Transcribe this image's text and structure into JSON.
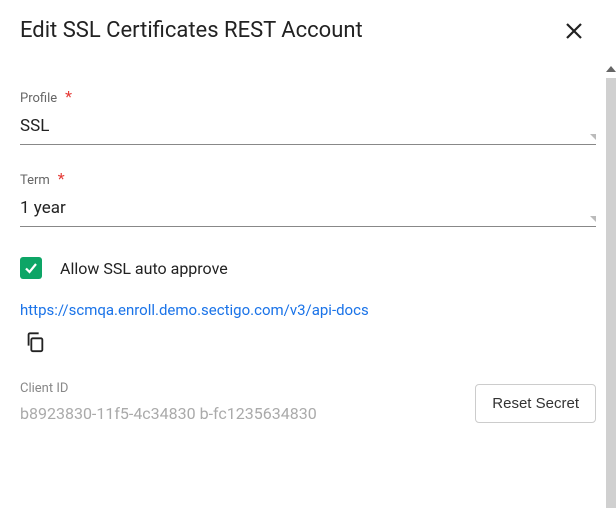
{
  "header": {
    "title": "Edit SSL Certificates REST Account"
  },
  "profile": {
    "label": "Profile",
    "value": "SSL"
  },
  "term": {
    "label": "Term",
    "value": "1 year"
  },
  "autoApprove": {
    "label": "Allow SSL auto approve",
    "checked": true
  },
  "docsUrl": "https://scmqa.enroll.demo.sectigo.com/v3/api-docs",
  "clientId": {
    "label": "Client ID",
    "value": "b8923830-11f5-4c34830 b-fc1235634830"
  },
  "buttons": {
    "resetSecret": "Reset Secret"
  }
}
